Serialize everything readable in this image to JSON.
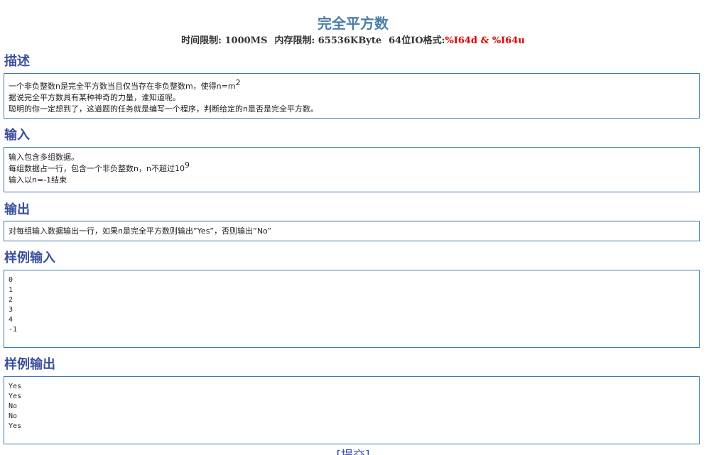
{
  "problem": {
    "title": "完全平方数",
    "limits": {
      "time": "时间限制: 1000MS",
      "memory": "内存限制: 65536KByte",
      "io_label": "64位IO格式:",
      "io_format": "%I64d & %I64u"
    }
  },
  "description": {
    "heading": "描述",
    "line1_prefix": "一个非负整数n是完全平方数当且仅当存在非负整数m，使得n=m",
    "line1_sup": "2",
    "line2": "据说完全平方数具有某种神奇的力量，谁知道呢。",
    "line3": "聪明的你一定想到了，这道题的任务就是编写一个程序，判断给定的n是否是完全平方数。"
  },
  "input": {
    "heading": "输入",
    "line1": "输入包含多组数据。",
    "line2_prefix": "每组数据占一行，包含一个非负整数n，n不超过10",
    "line2_sup": "9",
    "line3": "输入以n=-1结束"
  },
  "output": {
    "heading": "输出",
    "line1": "对每组输入数据输出一行，如果n是完全平方数则输出”Yes”，否则输出”No”"
  },
  "sample_input": {
    "heading": "样例输入",
    "text": "0\n1\n2\n3\n4\n-1"
  },
  "sample_output": {
    "heading": "样例输出",
    "text": "Yes\nYes\nNo\nNo\nYes"
  },
  "actions": {
    "bracket_open": "[",
    "submit_label": "提交",
    "bracket_close": "]"
  }
}
